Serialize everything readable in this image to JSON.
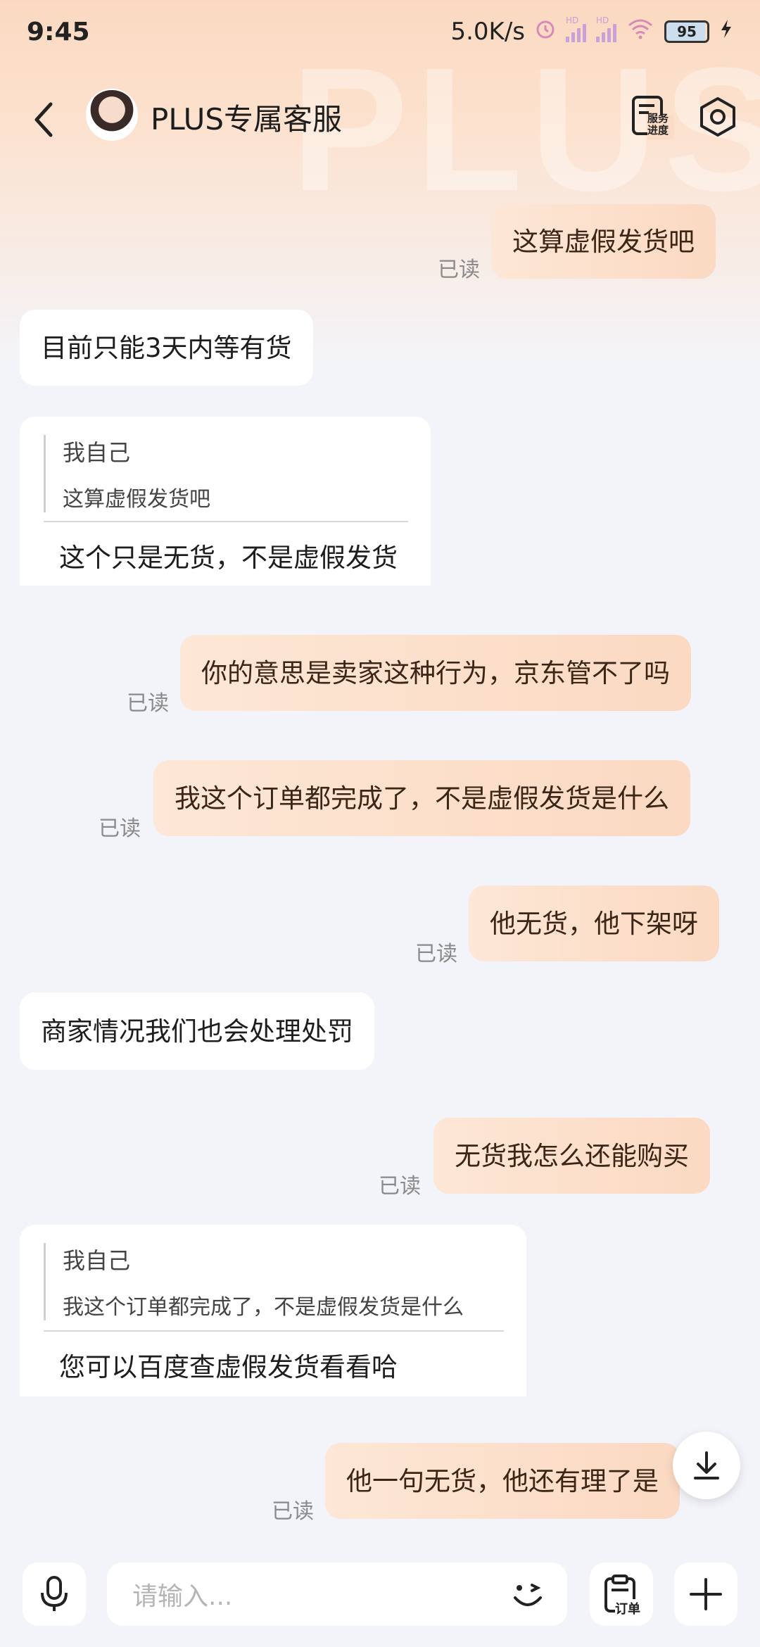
{
  "status_bar": {
    "time": "9:45",
    "net_speed": "5.0K/s",
    "hd1": "HD",
    "hd2": "HD",
    "battery": "95"
  },
  "header": {
    "title": "PLUS专属客服",
    "service_label_1": "服务",
    "service_label_2": "进度",
    "watermark": "PLUS"
  },
  "messages": {
    "m1": {
      "text": "这算虚假发货吧",
      "status": "已读"
    },
    "m2": {
      "text": "目前只能3天内等有货"
    },
    "m3": {
      "quote_name": "我自己",
      "quote_text": "这算虚假发货吧",
      "reply": "这个只是无货，不是虚假发货"
    },
    "m4": {
      "text": "你的意思是卖家这种行为，京东管不了吗",
      "status": "已读"
    },
    "m5": {
      "text": "我这个订单都完成了，不是虚假发货是什么",
      "status": "已读"
    },
    "m6": {
      "text": "他无货，他下架呀",
      "status": "已读"
    },
    "m7": {
      "text": "商家情况我们也会处理处罚"
    },
    "m8": {
      "text": "无货我怎么还能购买",
      "status": "已读"
    },
    "m9": {
      "quote_name": "我自己",
      "quote_text": "我这个订单都完成了，不是虚假发货是什么",
      "reply": "您可以百度查虚假发货看看哈"
    },
    "m10": {
      "text": "他一句无货，他还有理了是",
      "status": "已读"
    }
  },
  "input_bar": {
    "placeholder": "请输入...",
    "order_label": "订单"
  },
  "colors": {
    "accent_gradient_start": "#fde7d6",
    "accent_gradient_end": "#fbd9c2",
    "background": "#f3f4f9"
  }
}
